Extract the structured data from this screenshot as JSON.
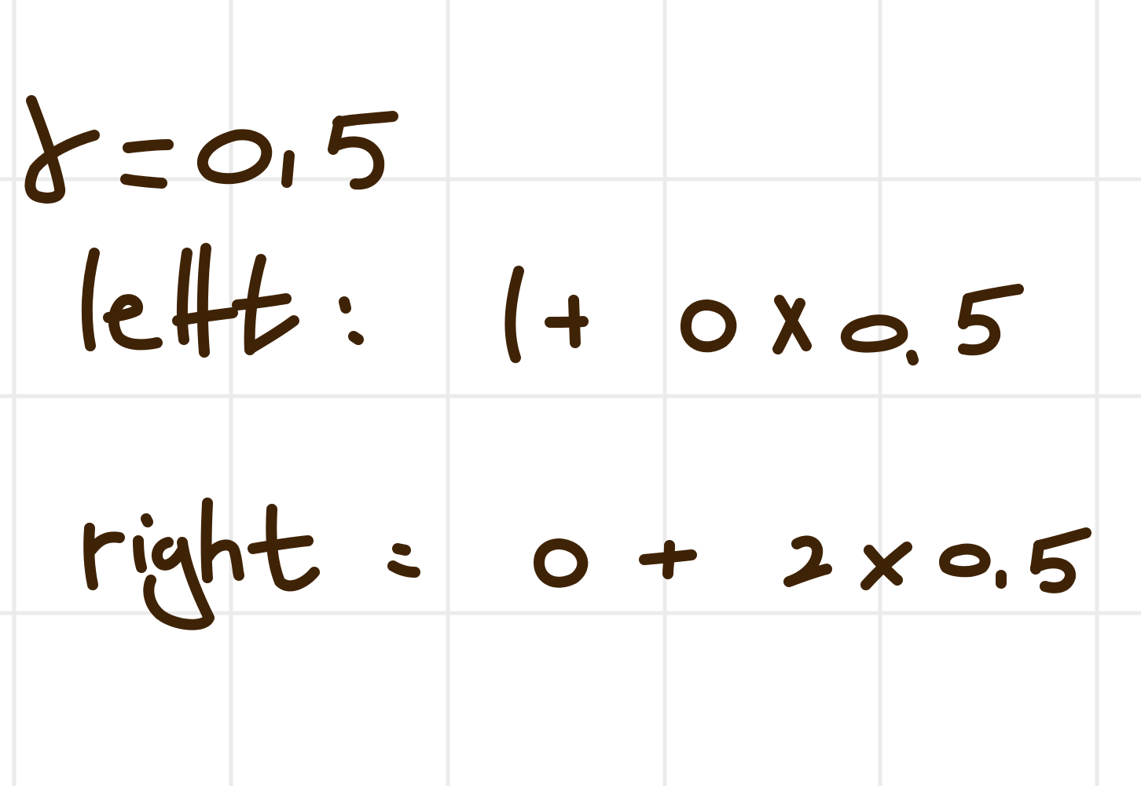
{
  "page": {
    "background_color": "#ffffff",
    "grid_color": "#ebebeb",
    "ink_color": "#3f2306"
  },
  "handwriting": {
    "line_1": "γ = 0.5",
    "line_2": "left :  1 + 0 x 0.5",
    "line_3": "right :  0 + 2 x 0.5"
  }
}
